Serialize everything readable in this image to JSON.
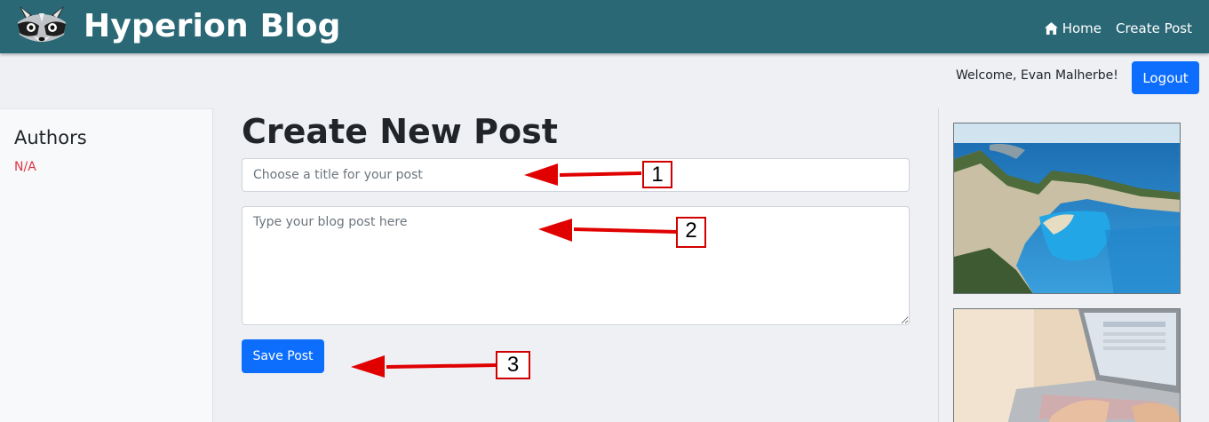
{
  "navbar": {
    "brand": "Hyperion Blog",
    "logo_icon": "raccoon-logo-icon",
    "links": [
      {
        "label": "Home",
        "icon": "home-icon"
      },
      {
        "label": "Create Post"
      }
    ],
    "background": "#2b6876"
  },
  "user": {
    "welcome_text": "Welcome, Evan Malherbe!",
    "logout_label": "Logout"
  },
  "sidebar": {
    "title": "Authors",
    "value": "N/A"
  },
  "main": {
    "page_title": "Create New Post",
    "title_placeholder": "Choose a title for your post",
    "body_placeholder": "Type your blog post here",
    "save_label": "Save Post"
  },
  "annotations": [
    {
      "number": "1"
    },
    {
      "number": "2"
    },
    {
      "number": "3"
    }
  ],
  "colors": {
    "primary": "#0d6efd",
    "danger": "#dc3545",
    "annotation": "#e00000"
  },
  "images": [
    {
      "subject": "coastal-cove-photo"
    },
    {
      "subject": "laptop-typing-photo"
    }
  ]
}
